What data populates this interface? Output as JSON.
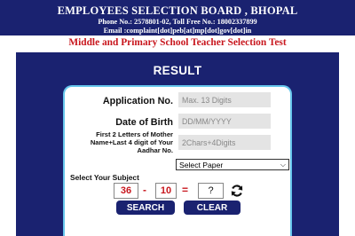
{
  "header": {
    "org_title": "EMPLOYEES SELECTION BOARD , BHOPAL",
    "phone_line": "Phone No.: 2578801-02, Toll Free No.: 18002337899",
    "email_line": "Email :complaint[dot]peb[at]mp[dot]gov[dot]in",
    "exam_title": "Middle and Primary School Teacher Selection Test"
  },
  "panel": {
    "heading": "RESULT"
  },
  "form": {
    "application_no": {
      "label": "Application No.",
      "placeholder": "Max. 13 Digits"
    },
    "dob": {
      "label": "Date of Birth",
      "placeholder": "DD/MM/YYYY"
    },
    "aadhar": {
      "label": "First 2 Letters of Mother Name+Last 4 digit of Your Aadhar No.",
      "placeholder": "2Chars+4Digits"
    },
    "subject": {
      "label": "Select Your Subject",
      "selected": "Select Paper"
    }
  },
  "captcha": {
    "operand_a": "36",
    "operator": "-",
    "operand_b": "10",
    "equals": "=",
    "answer": "?"
  },
  "buttons": {
    "search": "SEARCH",
    "clear": "CLEAR"
  },
  "icons": {
    "refresh": "refresh-icon",
    "dropdown": "chevron-down-icon"
  },
  "colors": {
    "navy": "#1a2270",
    "red": "#c8161d",
    "card_border": "#66c6ec"
  }
}
